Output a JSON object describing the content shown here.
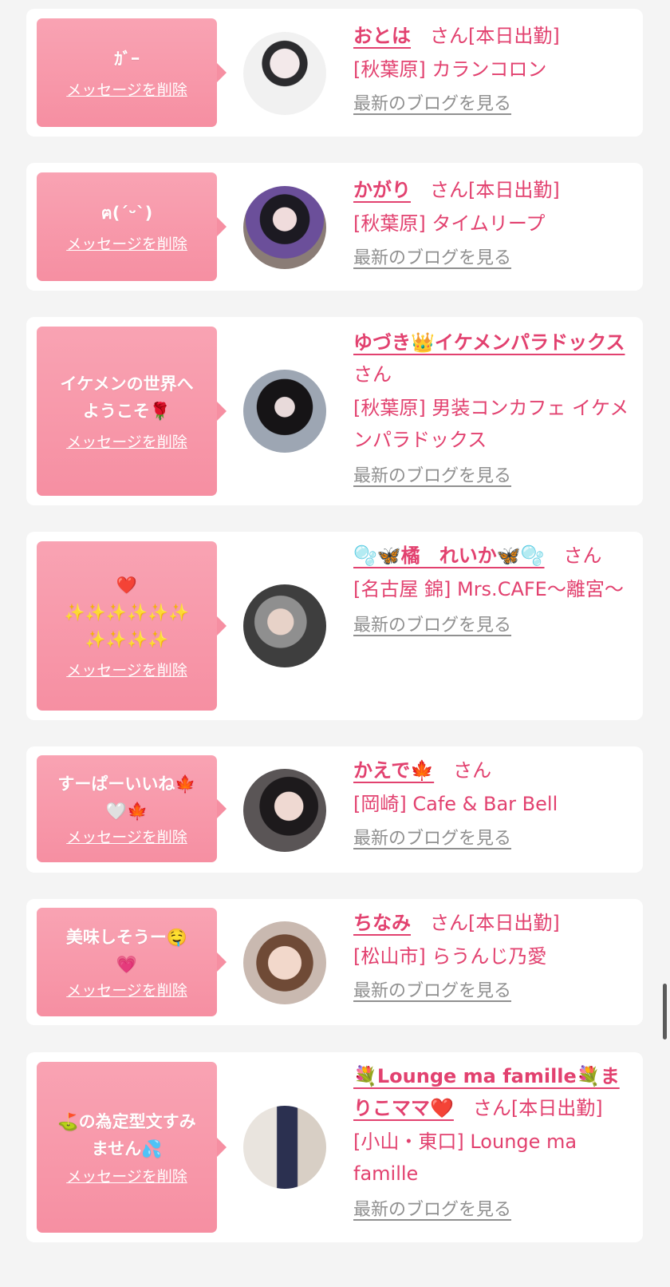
{
  "delete_label": "メッセージを削除",
  "blog_label": "最新のブログを見る",
  "san_label": "さん",
  "colors": {
    "accent": "#e2416f",
    "bubble": "#f68fa2",
    "link_gray": "#909090"
  },
  "items": [
    {
      "message": "ｶﾞｰ",
      "name": "おとは",
      "status": "[本日出勤]",
      "shop": "[秋葉原] カランコロン"
    },
    {
      "message": "ฅ(ˊᵕˋ)",
      "name": "かがり",
      "status": "[本日出勤]",
      "shop": "[秋葉原] タイムリープ"
    },
    {
      "message": "イケメンの世界へ\nようこそ🌹",
      "name": "ゆづき👑イケメンパラドックス",
      "status": "",
      "shop": "[秋葉原] 男装コンカフェ イケメンパラドックス"
    },
    {
      "message": "❤️\n✨✨✨✨✨✨\n✨✨✨✨",
      "name": "🫧🦋橘　れいか🦋🫧",
      "status": "",
      "shop": "[名古屋 錦] Mrs.CAFE〜離宮〜"
    },
    {
      "message": "すーぱーいいね🍁\n🤍🍁",
      "name": "かえで🍁",
      "status": "",
      "shop": "[岡崎] Cafe & Bar Bell"
    },
    {
      "message": "美味しそうー🤤\n💗",
      "name": "ちなみ",
      "status": "[本日出勤]",
      "shop": "[松山市] らうんじ乃愛"
    },
    {
      "message": "⛳️の為定型文すみ\nません💦",
      "name": "💐Lounge ma famille💐まりこママ❤️",
      "status": "[本日出勤]",
      "shop": "[小山・東口] Lounge ma famille"
    }
  ]
}
